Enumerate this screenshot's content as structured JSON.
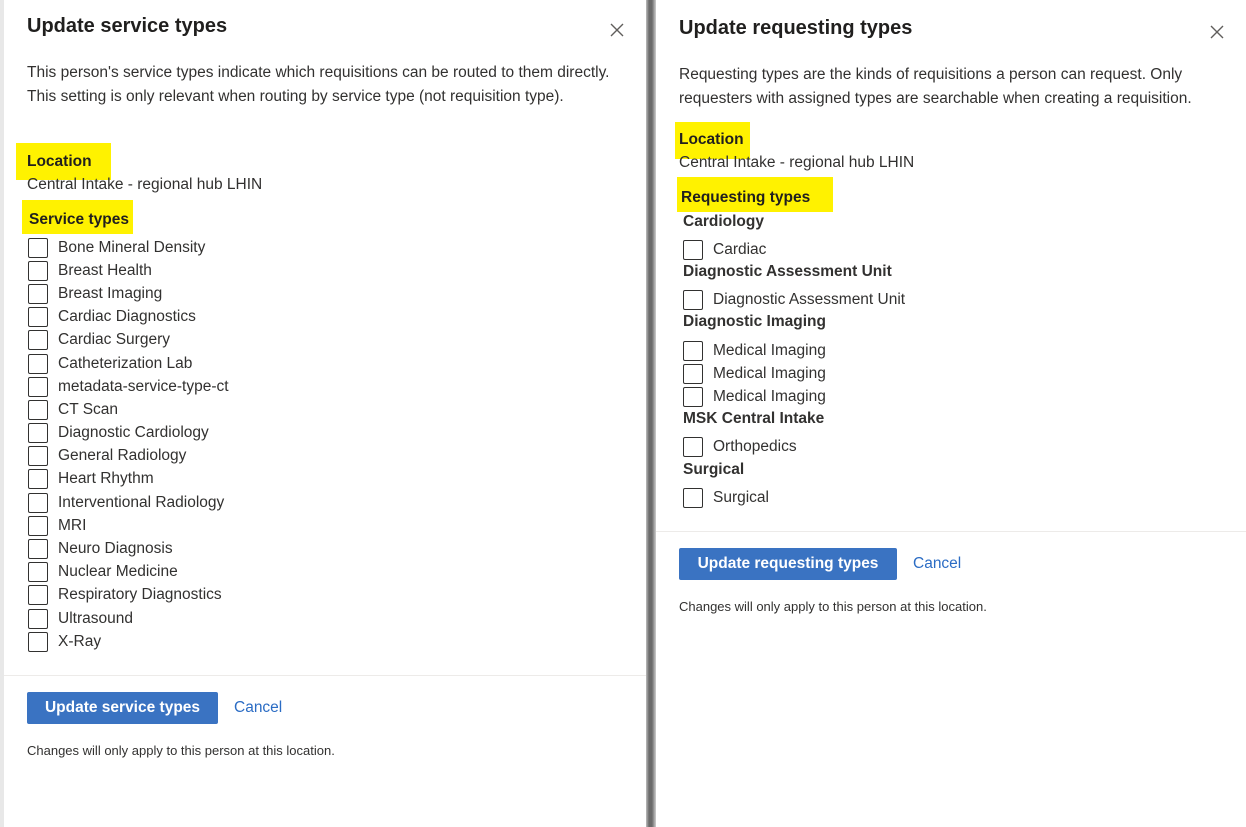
{
  "left": {
    "title": "Update service types",
    "description": "This person's service types indicate which requisitions can be routed to them directly. This setting is only relevant when routing by service type (not requisition type).",
    "location_label": "Location",
    "location_value": "Central Intake - regional hub LHIN",
    "service_types_label": "Service types",
    "service_types": [
      "Bone Mineral Density",
      "Breast Health",
      "Breast Imaging",
      "Cardiac Diagnostics",
      "Cardiac Surgery",
      "Catheterization Lab",
      "metadata-service-type-ct",
      "CT Scan",
      "Diagnostic Cardiology",
      "General Radiology",
      "Heart Rhythm",
      "Interventional Radiology",
      "MRI",
      "Neuro Diagnosis",
      "Nuclear Medicine",
      "Respiratory Diagnostics",
      "Ultrasound",
      "X-Ray"
    ],
    "submit_label": "Update service types",
    "cancel_label": "Cancel",
    "footnote": "Changes will only apply to this person at this location."
  },
  "right": {
    "title": "Update requesting types",
    "description": "Requesting types are the kinds of requisitions a person can request. Only requesters with assigned types are searchable when creating a requisition.",
    "location_label": "Location",
    "location_value": "Central Intake - regional hub LHIN",
    "requesting_types_label": "Requesting types",
    "groups": [
      {
        "name": "Cardiology",
        "items": [
          "Cardiac"
        ]
      },
      {
        "name": "Diagnostic Assessment Unit",
        "items": [
          "Diagnostic Assessment Unit"
        ]
      },
      {
        "name": "Diagnostic Imaging",
        "items": [
          "Medical Imaging",
          "Medical Imaging",
          "Medical Imaging"
        ]
      },
      {
        "name": "MSK Central Intake",
        "items": [
          "Orthopedics"
        ]
      },
      {
        "name": "Surgical",
        "items": [
          "Surgical"
        ]
      }
    ],
    "submit_label": "Update requesting types",
    "cancel_label": "Cancel",
    "footnote": "Changes will only apply to this person at this location."
  },
  "colors": {
    "highlight": "#fff200",
    "primary_button": "#3a73c2",
    "link": "#2b6cc4"
  },
  "icons": {
    "close": "close-icon"
  }
}
